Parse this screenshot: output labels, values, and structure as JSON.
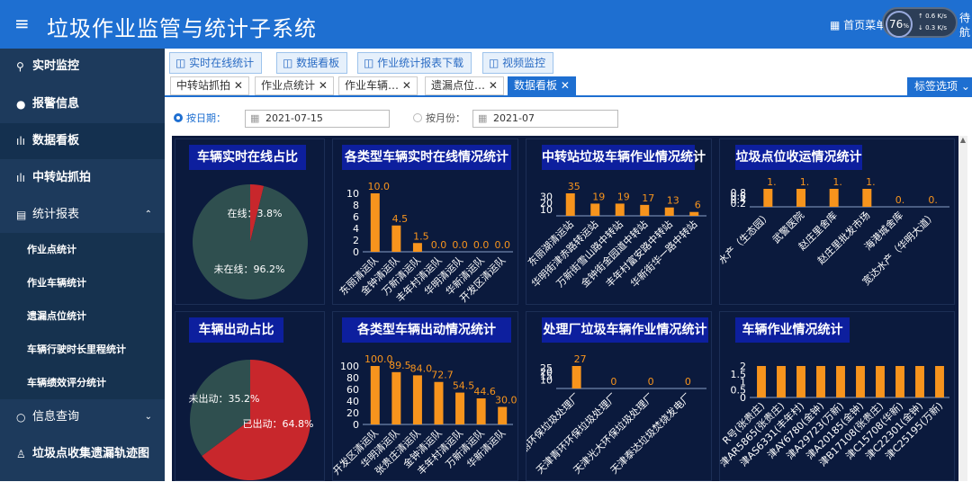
{
  "header": {
    "title": "垃圾作业监管与统计子系统",
    "home_menu": "首页菜单",
    "speed": "76",
    "speed_unit": "%",
    "up_rate": "0.6",
    "up_unit": "K/s",
    "down_rate": "0.3",
    "down_unit": "K/s",
    "right_text1": "待",
    "right_text2": "航"
  },
  "sidebar": {
    "items": [
      {
        "label": "实时监控",
        "icon": "location-icon"
      },
      {
        "label": "报警信息",
        "icon": "alarm-icon"
      },
      {
        "label": "数据看板",
        "icon": "bar-chart-icon"
      },
      {
        "label": "中转站抓拍",
        "icon": "bar-chart-icon"
      },
      {
        "label": "统计报表",
        "icon": "document-icon"
      },
      {
        "label": "作业点统计"
      },
      {
        "label": "作业车辆统计"
      },
      {
        "label": "遗漏点位统计"
      },
      {
        "label": "车辆行驶时长里程统计"
      },
      {
        "label": "车辆绩效评分统计"
      },
      {
        "label": "信息查询",
        "icon": "search-icon"
      },
      {
        "label": "垃圾点收集遗漏轨迹图",
        "icon": "person-icon"
      }
    ]
  },
  "nav_buttons": [
    "实时在线统计",
    "数据看板",
    "作业统计报表下载",
    "视频监控"
  ],
  "tabs": [
    "中转站抓拍",
    "作业点统计",
    "作业车辆…",
    "遗漏点位…",
    "数据看板"
  ],
  "tag_options": "标签选项",
  "filter": {
    "by_date_label": "按日期：",
    "date_value": "2021-07-15",
    "by_month_label": "按月份：",
    "month_value": "2021-07"
  },
  "chart_data": [
    {
      "type": "pie",
      "title": "车辆实时在线占比",
      "slices": [
        {
          "name": "在线",
          "value": 3.8,
          "label": "在线：3.8%",
          "color": "#c8272c"
        },
        {
          "name": "未在线",
          "value": 96.2,
          "label": "未在线：96.2%",
          "color": "#2f4f4f"
        }
      ]
    },
    {
      "type": "bar",
      "title": "各类型车辆实时在线情况统计",
      "categories": [
        "东丽清运队",
        "金钟清运队",
        "万新清运队",
        "丰年村清运队",
        "华明清运队",
        "华新清运队",
        "开发区清运队"
      ],
      "values": [
        10.0,
        4.5,
        1.5,
        0.0,
        0.0,
        0.0,
        0.0
      ],
      "value_labels": [
        "10.0",
        "4.5",
        "1.5",
        "0.0",
        "0.0",
        "0.0",
        "0.0"
      ],
      "yticks": [
        "0",
        "2",
        "4",
        "6",
        "8",
        "10"
      ],
      "ylim": [
        0,
        10
      ]
    },
    {
      "type": "bar",
      "title": "中转站垃圾车辆作业情况统计",
      "categories": [
        "东丽湖清运站",
        "华明街津赤路转运站",
        "万新街雪山路中转站",
        "金钟街金园道中转站",
        "丰年村富安路中转站",
        "华新街华一路中转站"
      ],
      "values": [
        35,
        19,
        19,
        17,
        13,
        6
      ],
      "value_labels": [
        "35",
        "19",
        "19",
        "17",
        "13",
        "6"
      ],
      "yticks": [
        "10",
        "20",
        "30"
      ],
      "ylim": [
        0,
        35
      ]
    },
    {
      "type": "bar",
      "title": "垃圾点位收运情况统计",
      "categories": [
        "水产（生态园）",
        "武警医院",
        "赵庄里舍库",
        "赵庄里批发市场",
        "海港城舍库",
        "宽达水产（华明大道）"
      ],
      "values": [
        1,
        1,
        1,
        1,
        0,
        0
      ],
      "value_labels": [
        "1.",
        "1.",
        "1.",
        "1.",
        "0.",
        "0."
      ],
      "yticks": [
        "0.2",
        "0.4",
        "0.6",
        "0.8"
      ],
      "ylim": [
        0,
        1
      ]
    },
    {
      "type": "pie",
      "title": "车辆出动占比",
      "slices": [
        {
          "name": "已出动",
          "value": 64.8,
          "label": "已出动：64.8%",
          "color": "#c8272c"
        },
        {
          "name": "未出动",
          "value": 35.2,
          "label": "未出动：35.2%",
          "color": "#2f4f4f"
        }
      ]
    },
    {
      "type": "bar",
      "title": "各类型车辆出动情况统计",
      "categories": [
        "开发区清运队",
        "华明清运队",
        "张贵庄清运队",
        "金钟清运队",
        "丰年村清运队",
        "万新清运队",
        "华新清运队"
      ],
      "values": [
        100.0,
        89.5,
        84.0,
        72.7,
        54.5,
        44.6,
        30.0
      ],
      "value_labels": [
        "100.0",
        "89.5",
        "84.0",
        "72.7",
        "54.5",
        "44.6",
        "30.0"
      ],
      "yticks": [
        "0",
        "20",
        "40",
        "60",
        "80",
        "100"
      ],
      "ylim": [
        0,
        100
      ]
    },
    {
      "type": "bar",
      "title": "处理厂垃圾车辆作业情况统计",
      "categories": [
        "东丽环保垃圾处理厂",
        "天津青环环保垃圾处理厂",
        "天津光大环保垃圾处理厂",
        "天津泰达垃圾焚烧发电厂"
      ],
      "values": [
        27,
        0,
        0,
        0
      ],
      "value_labels": [
        "27",
        "0",
        "0",
        "0"
      ],
      "yticks": [
        "10",
        "15",
        "20",
        "25"
      ],
      "ylim": [
        0,
        27
      ]
    },
    {
      "type": "bar",
      "title": "车辆作业情况统计",
      "categories": [
        "R号(张贵庄)",
        "津AR5865(张贵庄)",
        "津AS6331(丰年村)",
        "津AY6780(金钟)",
        "津A29723(万新)",
        "津A20185(金钟)",
        "津B17108(张贵庄)",
        "津C15708(华新)",
        "津C22301(金钟)",
        "津C25195(万新)"
      ],
      "values": [
        2,
        2,
        2,
        2,
        2,
        2,
        2,
        2,
        2,
        2
      ],
      "value_labels": [],
      "yticks": [
        "0",
        "0.5",
        "1",
        "1.5",
        "2"
      ],
      "ylim": [
        0,
        2
      ]
    }
  ]
}
